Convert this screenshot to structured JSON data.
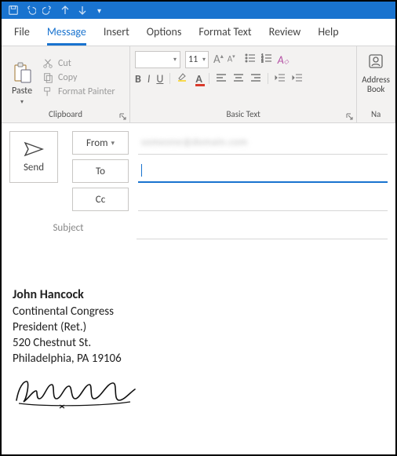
{
  "qat": {
    "save": "save-icon",
    "undo": "undo-icon",
    "redo": "redo-icon",
    "up": "up-icon",
    "down": "down-icon"
  },
  "tabs": {
    "file": "File",
    "message": "Message",
    "insert": "Insert",
    "options": "Options",
    "formattext": "Format Text",
    "review": "Review",
    "help": "Help",
    "active": "message"
  },
  "ribbon": {
    "clipboard": {
      "label": "Clipboard",
      "paste": "Paste",
      "cut": "Cut",
      "copy": "Copy",
      "format_painter": "Format Painter"
    },
    "basictext": {
      "label": "Basic Text",
      "font_name": "",
      "font_size": "11",
      "bold": "B",
      "italic": "I",
      "underline": "U"
    },
    "names": {
      "label": "Na",
      "address_book": "Address Book"
    }
  },
  "compose": {
    "send": "Send",
    "from_label": "From",
    "from_value": "",
    "to_label": "To",
    "to_value": "",
    "cc_label": "Cc",
    "cc_value": "",
    "subject_label": "Subject",
    "subject_value": ""
  },
  "body": {
    "sig_name": "John Hancock",
    "sig_line1": "Continental Congress",
    "sig_line2": "President (Ret.)",
    "sig_line3": "520 Chestnut St.",
    "sig_line4": "Philadelphia, PA  19106"
  }
}
